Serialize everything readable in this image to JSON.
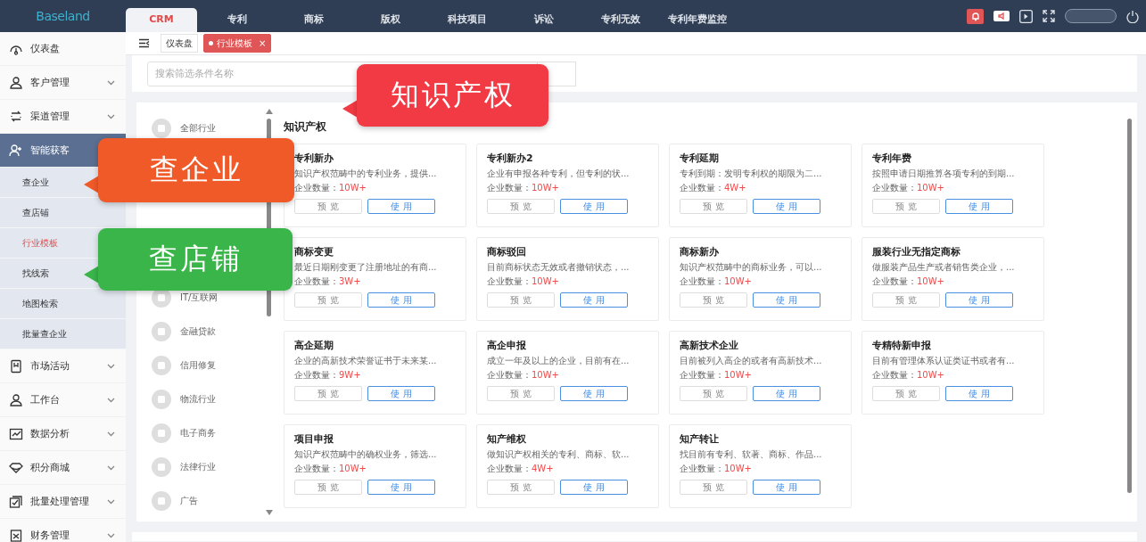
{
  "header": {
    "logo": "Baseland",
    "tabs": [
      {
        "label": "CRM",
        "selected": true
      },
      {
        "label": "专利",
        "selected": false
      },
      {
        "label": "商标",
        "selected": false
      },
      {
        "label": "版权",
        "selected": false
      },
      {
        "label": "科技项目",
        "selected": false
      },
      {
        "label": "诉讼",
        "selected": false
      },
      {
        "label": "专利无效",
        "selected": false
      },
      {
        "label": "专利年费监控",
        "selected": false
      }
    ]
  },
  "sidebar": {
    "items": [
      {
        "label": "仪表盘",
        "expandable": false,
        "selected": false
      },
      {
        "label": "客户管理",
        "expandable": true,
        "selected": false
      },
      {
        "label": "渠道管理",
        "expandable": true,
        "selected": false
      },
      {
        "label": "智能获客",
        "selected": true,
        "children": [
          {
            "label": "查企业",
            "selected": false
          },
          {
            "label": "查店铺",
            "selected": false
          },
          {
            "label": "行业模板",
            "selected": true
          },
          {
            "label": "找线索",
            "selected": false
          },
          {
            "label": "地图检索",
            "selected": false
          },
          {
            "label": "批量查企业",
            "selected": false
          }
        ]
      },
      {
        "label": "市场活动",
        "expandable": true,
        "selected": false
      },
      {
        "label": "工作台",
        "expandable": true,
        "selected": false
      },
      {
        "label": "数据分析",
        "expandable": true,
        "selected": false
      },
      {
        "label": "积分商城",
        "expandable": true,
        "selected": false
      },
      {
        "label": "批量处理管理",
        "expandable": true,
        "selected": false
      },
      {
        "label": "财务管理",
        "expandable": true,
        "selected": false
      }
    ]
  },
  "tag_bar": {
    "tags": [
      {
        "label": "仪表盘",
        "selected": false
      },
      {
        "label": "行业模板",
        "selected": true,
        "close": "×"
      }
    ]
  },
  "search": {
    "placeholder": "搜索筛选条件名称"
  },
  "industries": [
    {
      "kind": "item",
      "label": "全部行业"
    },
    {
      "kind": "covered"
    },
    {
      "kind": "covered"
    },
    {
      "kind": "covered"
    },
    {
      "kind": "covered"
    },
    {
      "kind": "item",
      "label": "IT/互联网"
    },
    {
      "kind": "item",
      "label": "金融贷款"
    },
    {
      "kind": "item",
      "label": "信用修复"
    },
    {
      "kind": "item",
      "label": "物流行业"
    },
    {
      "kind": "item",
      "label": "电子商务"
    },
    {
      "kind": "item",
      "label": "法律行业"
    },
    {
      "kind": "item",
      "label": "广告"
    }
  ],
  "section_title": "知识产权",
  "templates": [
    {
      "title": "专利新办",
      "desc": "知识产权范畴中的专利业务，提供...",
      "count_label": "企业数量：",
      "count": "10W+",
      "preview": "预 览",
      "use": "使 用"
    },
    {
      "title": "专利新办2",
      "desc": "企业有申报各种专利，但专利的状...",
      "count_label": "企业数量：",
      "count": "10W+",
      "preview": "预 览",
      "use": "使 用"
    },
    {
      "title": "专利延期",
      "desc": "专利到期：发明专利权的期限为二...",
      "count_label": "企业数量：",
      "count": "4W+",
      "preview": "预 览",
      "use": "使 用"
    },
    {
      "title": "专利年费",
      "desc": "按照申请日期推算各项专利的到期...",
      "count_label": "企业数量：",
      "count": "10W+",
      "preview": "预 览",
      "use": "使 用"
    },
    {
      "title": "商标变更",
      "desc": "最近日期刚变更了注册地址的有商...",
      "count_label": "企业数量：",
      "count": "3W+",
      "preview": "预 览",
      "use": "使 用"
    },
    {
      "title": "商标驳回",
      "desc": "目前商标状态无效或者撤销状态，...",
      "count_label": "企业数量：",
      "count": "10W+",
      "preview": "预 览",
      "use": "使 用"
    },
    {
      "title": "商标新办",
      "desc": "知识产权范畴中的商标业务，可以...",
      "count_label": "企业数量：",
      "count": "10W+",
      "preview": "预 览",
      "use": "使 用"
    },
    {
      "title": "服装行业无指定商标",
      "desc": "做服装产品生产或者销售类企业，...",
      "count_label": "企业数量：",
      "count": "10W+",
      "preview": "预 览",
      "use": "使 用"
    },
    {
      "title": "高企延期",
      "desc": "企业的高新技术荣誉证书于未来某...",
      "count_label": "企业数量：",
      "count": "9W+",
      "preview": "预 览",
      "use": "使 用"
    },
    {
      "title": "高企申报",
      "desc": "成立一年及以上的企业，目前有在...",
      "count_label": "企业数量：",
      "count": "10W+",
      "preview": "预 览",
      "use": "使 用"
    },
    {
      "title": "高新技术企业",
      "desc": "目前被列入高企的或者有高新技术...",
      "count_label": "企业数量：",
      "count": "10W+",
      "preview": "预 览",
      "use": "使 用"
    },
    {
      "title": "专精特新申报",
      "desc": "目前有管理体系认证类证书或者有...",
      "count_label": "企业数量：",
      "count": "10W+",
      "preview": "预 览",
      "use": "使 用"
    },
    {
      "title": "项目申报",
      "desc": "知识产权范畴中的确权业务，筛选...",
      "count_label": "企业数量：",
      "count": "10W+",
      "preview": "预 览",
      "use": "使 用"
    },
    {
      "title": "知产维权",
      "desc": "做知识产权相关的专利、商标、软...",
      "count_label": "企业数量：",
      "count": "4W+",
      "preview": "预 览",
      "use": "使 用"
    },
    {
      "title": "知产转让",
      "desc": "找目前有专利、软著、商标、作品...",
      "count_label": "企业数量：",
      "count": "10W+",
      "preview": "预 览",
      "use": "使 用"
    }
  ],
  "callouts": [
    {
      "label": "知识产权",
      "color": "#f23a44"
    },
    {
      "label": "查企业",
      "color": "#f05a28"
    },
    {
      "label": "查店铺",
      "color": "#39b54a"
    }
  ]
}
